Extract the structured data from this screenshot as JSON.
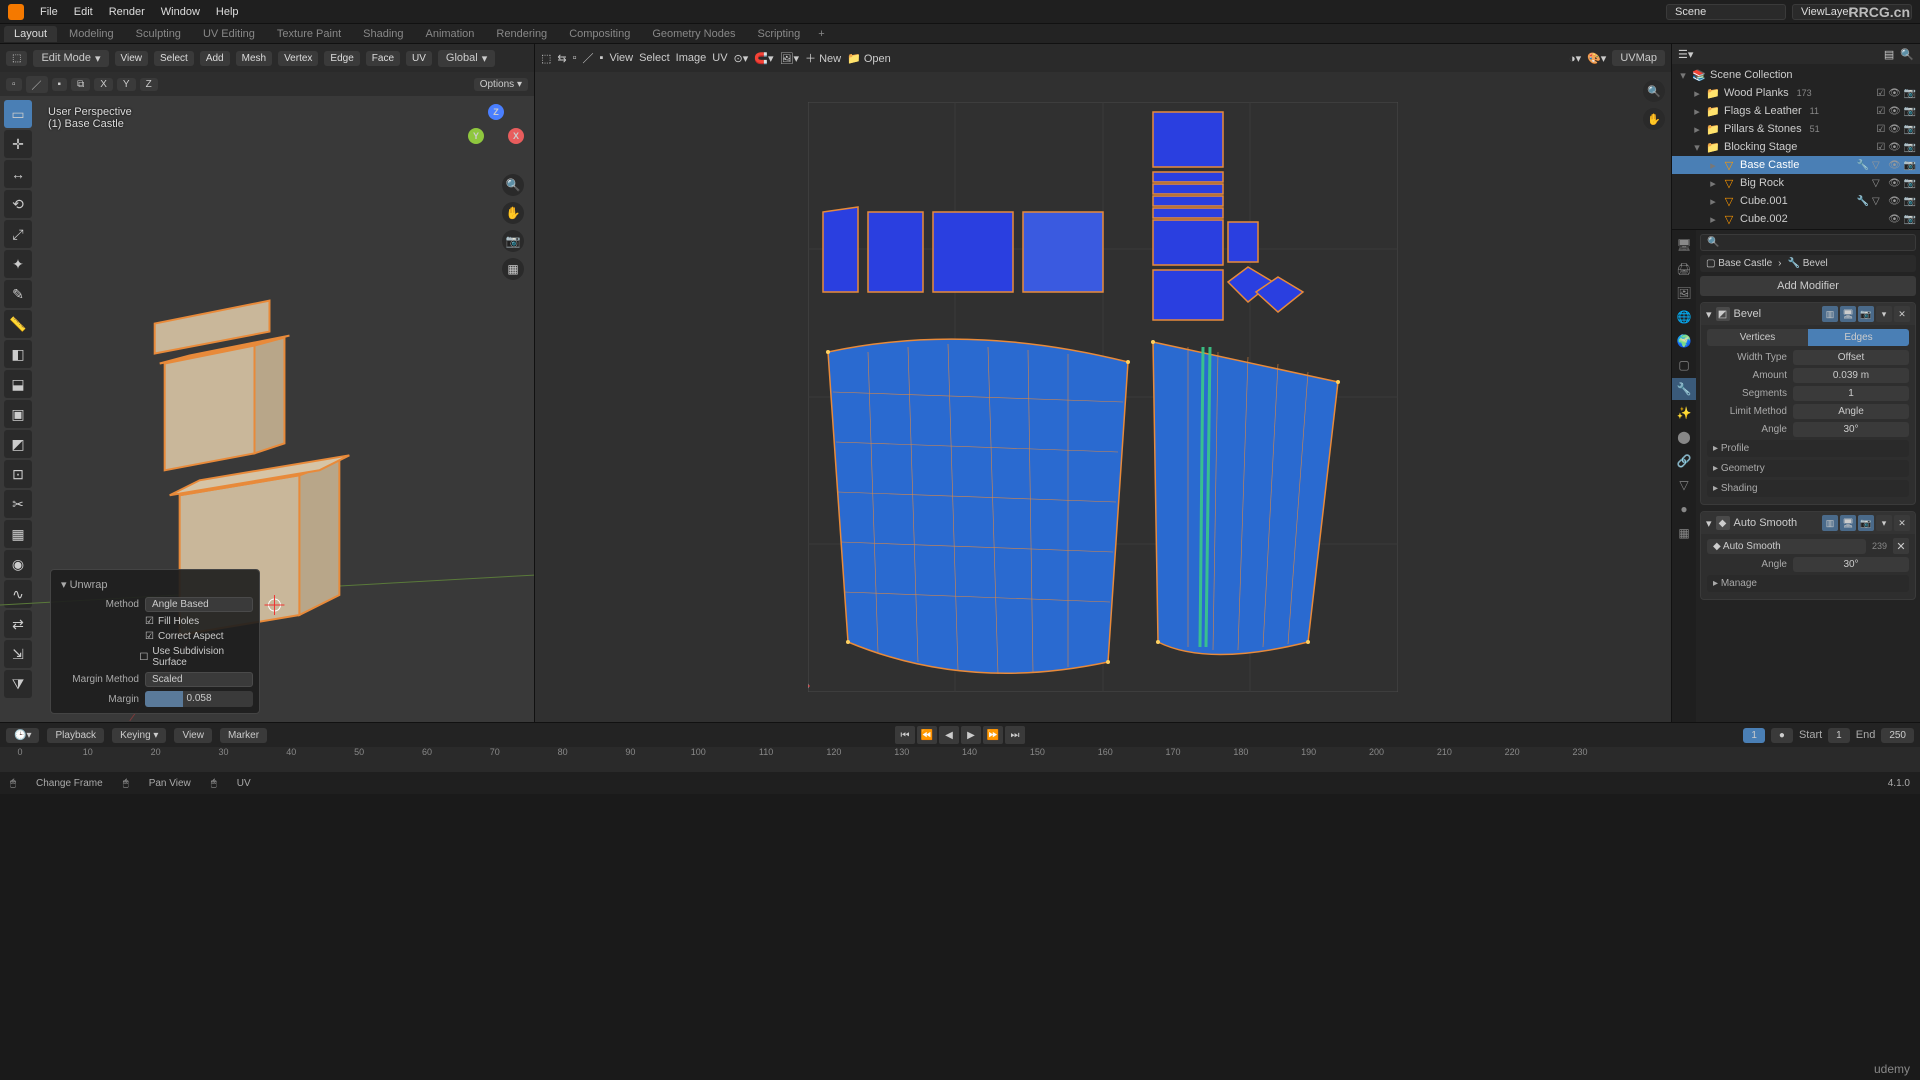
{
  "top_menu": {
    "items": [
      "File",
      "Edit",
      "Render",
      "Window",
      "Help"
    ]
  },
  "top_right": {
    "scene_label": "Scene",
    "viewlayer_label": "ViewLayer"
  },
  "workspace_tabs": [
    "Layout",
    "Modeling",
    "Sculpting",
    "UV Editing",
    "Texture Paint",
    "Shading",
    "Animation",
    "Rendering",
    "Compositing",
    "Geometry Nodes",
    "Scripting"
  ],
  "viewport": {
    "mode": "Edit Mode",
    "header_menus": [
      "View",
      "Select",
      "Add",
      "Mesh",
      "Vertex",
      "Edge",
      "Face",
      "UV"
    ],
    "orientation": "Global",
    "options_label": "Options",
    "axes": [
      "X",
      "Y",
      "Z"
    ],
    "info_line1": "User Perspective",
    "info_line2": "(1) Base Castle"
  },
  "uv": {
    "header_menus": [
      "View",
      "Select",
      "Image",
      "UV"
    ],
    "new_label": "New",
    "open_label": "Open",
    "map_name": "UVMap"
  },
  "operator": {
    "title": "Unwrap",
    "method_label": "Method",
    "method_value": "Angle Based",
    "fill_holes_label": "Fill Holes",
    "correct_aspect_label": "Correct Aspect",
    "use_subsurf_label": "Use Subdivision Surface",
    "margin_method_label": "Margin Method",
    "margin_method_value": "Scaled",
    "margin_label": "Margin",
    "margin_value": "0.058"
  },
  "outliner": {
    "root": "Scene Collection",
    "collections": [
      {
        "name": "Wood Planks",
        "count": "173"
      },
      {
        "name": "Flags & Leather",
        "count": "11"
      },
      {
        "name": "Pillars & Stones",
        "count": "51"
      },
      {
        "name": "Blocking Stage",
        "count": ""
      }
    ],
    "objects": [
      {
        "name": "Base Castle",
        "active": true
      },
      {
        "name": "Big Rock",
        "active": false
      },
      {
        "name": "Cube.001",
        "active": false
      },
      {
        "name": "Cube.002",
        "active": false
      }
    ]
  },
  "properties": {
    "search_placeholder": "Search",
    "breadcrumb_obj": "Base Castle",
    "breadcrumb_mod": "Bevel",
    "add_modifier_label": "Add Modifier",
    "bevel": {
      "name": "Bevel",
      "seg_vertices": "Vertices",
      "seg_edges": "Edges",
      "width_type_label": "Width Type",
      "width_type_value": "Offset",
      "amount_label": "Amount",
      "amount_value": "0.039 m",
      "segments_label": "Segments",
      "segments_value": "1",
      "limit_method_label": "Limit Method",
      "limit_method_value": "Angle",
      "angle_label": "Angle",
      "angle_value": "30°",
      "sub_profile": "Profile",
      "sub_geometry": "Geometry",
      "sub_shading": "Shading"
    },
    "autosmooth": {
      "name": "Auto Smooth",
      "inner_name": "Auto Smooth",
      "count": "239",
      "angle_label": "Angle",
      "angle_value": "30°",
      "sub_manage": "Manage"
    }
  },
  "timeline": {
    "playback": "Playback",
    "keying": "Keying",
    "view": "View",
    "marker": "Marker",
    "current": "1",
    "start_label": "Start",
    "start_value": "1",
    "end_label": "End",
    "end_value": "250",
    "ticks": [
      "0",
      "10",
      "20",
      "30",
      "40",
      "50",
      "60",
      "70",
      "80",
      "90",
      "100",
      "110",
      "120",
      "130",
      "140",
      "150",
      "160",
      "170",
      "180",
      "190",
      "200",
      "210",
      "220",
      "230"
    ]
  },
  "statusbar": {
    "left1": "Change Frame",
    "left2": "Pan View",
    "left3": "UV",
    "version": "4.1.0"
  },
  "branding": {
    "site": "RRCG.cn",
    "udemy": "udemy"
  }
}
